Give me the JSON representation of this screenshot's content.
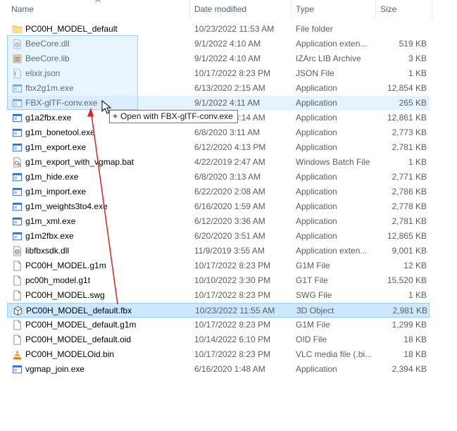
{
  "headers": {
    "name": "Name",
    "date": "Date modified",
    "type": "Type",
    "size": "Size"
  },
  "files": [
    {
      "name": "PC00H_MODEL_default",
      "date": "10/23/2022 11:53 AM",
      "type": "File folder",
      "size": "",
      "icon": "folder-icon"
    },
    {
      "name": "BeeCore.dll",
      "date": "9/1/2022 4:10 AM",
      "type": "Application exten...",
      "size": "519 KB",
      "icon": "dll-icon"
    },
    {
      "name": "BeeCore.lib",
      "date": "9/1/2022 4:10 AM",
      "type": "IZArc LIB Archive",
      "size": "3 KB",
      "icon": "lib-icon"
    },
    {
      "name": "elixir.json",
      "date": "10/17/2022 8:23 PM",
      "type": "JSON File",
      "size": "1 KB",
      "icon": "json-icon"
    },
    {
      "name": "fbx2g1m.exe",
      "date": "6/13/2020 2:15 AM",
      "type": "Application",
      "size": "12,854 KB",
      "icon": "exe-icon"
    },
    {
      "name": "FBX-glTF-conv.exe",
      "date": "9/1/2022 4:11 AM",
      "type": "Application",
      "size": "265 KB",
      "icon": "exe-icon"
    },
    {
      "name": "g1a2fbx.exe",
      "date": "6/12/2020 3:14 AM",
      "type": "Application",
      "size": "12,861 KB",
      "icon": "exe-icon"
    },
    {
      "name": "g1m_bonetool.exe",
      "date": "6/8/2020 3:11 AM",
      "type": "Application",
      "size": "2,773 KB",
      "icon": "exe-icon"
    },
    {
      "name": "g1m_export.exe",
      "date": "6/12/2020 4:13 PM",
      "type": "Application",
      "size": "2,781 KB",
      "icon": "exe-icon"
    },
    {
      "name": "g1m_export_with_vgmap.bat",
      "date": "4/22/2019 2:47 AM",
      "type": "Windows Batch File",
      "size": "1 KB",
      "icon": "bat-icon"
    },
    {
      "name": "g1m_hide.exe",
      "date": "6/8/2020 3:13 AM",
      "type": "Application",
      "size": "2,771 KB",
      "icon": "exe-icon"
    },
    {
      "name": "g1m_import.exe",
      "date": "6/22/2020 2:08 AM",
      "type": "Application",
      "size": "2,786 KB",
      "icon": "exe-icon"
    },
    {
      "name": "g1m_weights3to4.exe",
      "date": "6/16/2020 1:59 AM",
      "type": "Application",
      "size": "2,778 KB",
      "icon": "exe-icon"
    },
    {
      "name": "g1m_xml.exe",
      "date": "6/12/2020 3:36 AM",
      "type": "Application",
      "size": "2,781 KB",
      "icon": "exe-icon"
    },
    {
      "name": "g1m2fbx.exe",
      "date": "6/20/2020 3:51 AM",
      "type": "Application",
      "size": "12,865 KB",
      "icon": "exe-icon"
    },
    {
      "name": "libfbxsdk.dll",
      "date": "11/9/2019 3:55 AM",
      "type": "Application exten...",
      "size": "9,001 KB",
      "icon": "dll-icon"
    },
    {
      "name": "PC00H_MODEL.g1m",
      "date": "10/17/2022 8:23 PM",
      "type": "G1M File",
      "size": "12 KB",
      "icon": "file-icon"
    },
    {
      "name": "pc00h_model.g1t",
      "date": "10/10/2022 3:30 PM",
      "type": "G1T File",
      "size": "15,520 KB",
      "icon": "file-icon"
    },
    {
      "name": "PC00H_MODEL.swg",
      "date": "10/17/2022 8:23 PM",
      "type": "SWG File",
      "size": "1 KB",
      "icon": "file-icon"
    },
    {
      "name": "PC00H_MODEL_default.fbx",
      "date": "10/23/2022 11:55 AM",
      "type": "3D Object",
      "size": "2,981 KB",
      "icon": "3d-object-icon"
    },
    {
      "name": "PC00H_MODEL_default.g1m",
      "date": "10/17/2022 8:23 PM",
      "type": "G1M File",
      "size": "1,299 KB",
      "icon": "file-icon"
    },
    {
      "name": "PC00H_MODEL_default.oid",
      "date": "10/14/2022 6:10 PM",
      "type": "OID File",
      "size": "18 KB",
      "icon": "file-icon"
    },
    {
      "name": "PC00H_MODELOid.bin",
      "date": "10/17/2022 8:23 PM",
      "type": "VLC media file (.bi...",
      "size": "18 KB",
      "icon": "vlc-icon"
    },
    {
      "name": "vgmap_join.exe",
      "date": "6/16/2020 1:48 AM",
      "type": "Application",
      "size": "2,394 KB",
      "icon": "exe-icon"
    }
  ],
  "drag_tooltip": {
    "plus": "+",
    "text": "Open with FBX-glTF-conv.exe"
  },
  "colors": {
    "selection": "#cce8ff",
    "hover": "#e5f3ff",
    "arrow": "#e02020"
  }
}
